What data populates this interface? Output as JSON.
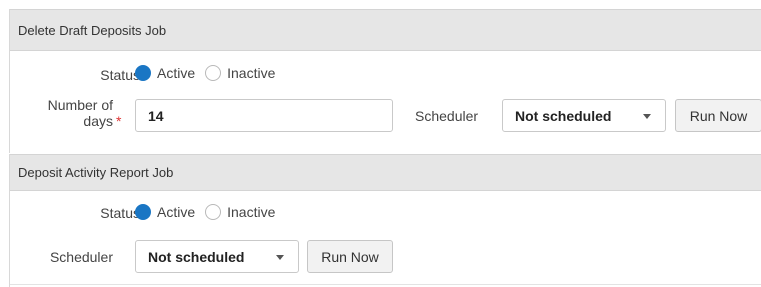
{
  "delete_job": {
    "title": "Delete Draft Deposits Job",
    "status_label": "Status",
    "status_options": [
      {
        "label": "Active",
        "selected": true
      },
      {
        "label": "Inactive",
        "selected": false
      }
    ],
    "days_label_line1": "Number of",
    "days_label_line2": "days",
    "required_mark": "*",
    "days_value": "14",
    "scheduler_label": "Scheduler",
    "scheduler_value": "Not scheduled",
    "run_now_label": "Run Now"
  },
  "activity_job": {
    "title": "Deposit Activity Report Job",
    "status_label": "Status",
    "status_options": [
      {
        "label": "Active",
        "selected": true
      },
      {
        "label": "Inactive",
        "selected": false
      }
    ],
    "scheduler_label": "Scheduler",
    "scheduler_value": "Not scheduled",
    "run_now_label": "Run Now"
  },
  "colors": {
    "accent": "#1a76c4",
    "header_bg": "#e6e6e6",
    "required": "#dd3333"
  }
}
